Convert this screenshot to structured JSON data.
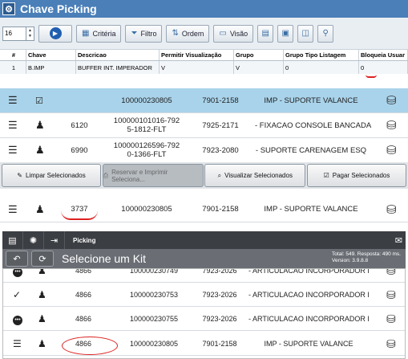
{
  "window": {
    "title": "Chave Picking"
  },
  "toolbar": {
    "spin_value": "16",
    "criteria_label": "Critéria",
    "filter_label": "Filtro",
    "order_label": "Ordem",
    "view_label": "Visão"
  },
  "grid": {
    "headers": [
      "#",
      "Chave",
      "Descricao",
      "Permitir Visualização",
      "Grupo",
      "Grupo Tipo Listagem",
      "Bloqueia Usuar"
    ],
    "row": [
      "1",
      "B.IMP",
      "BUFFER INT. IMPERADOR",
      "V",
      "V",
      "0",
      "0"
    ]
  },
  "list_top": [
    {
      "code": "",
      "order": "100000230805",
      "ref": "7901-2158",
      "desc": "IMP - SUPORTE VALANCE"
    },
    {
      "code": "6120",
      "order_line1": "100000101016-792",
      "order_line2": "5-1812-FLT",
      "ref": "7925-2171",
      "desc": "- FIXACAO CONSOLE BANCADA"
    },
    {
      "code": "6990",
      "order_line1": "100000126596-792",
      "order_line2": "0-1366-FLT",
      "ref": "7923-2080",
      "desc": "- SUPORTE CARENAGEM ESQ"
    }
  ],
  "actions": {
    "clear": "Limpar Selecionados",
    "reserve_print": "Reservar e Imprimir Selecionа...",
    "view_selected": "Visualizar Selecionados",
    "pay_selected": "Pagar Selecionados"
  },
  "single_row": {
    "code": "3737",
    "order": "100000230805",
    "ref": "7901-2158",
    "desc": "IMP - SUPORTE VALANCE"
  },
  "mobile": {
    "top_title": "Picking",
    "sub_title": "Selecione um Kit",
    "stats_line1": "Total: 549. Resposta: 490 ms.",
    "stats_line2": "Version: 3.9.8.8"
  },
  "list_bottom": [
    {
      "code": "4866",
      "order": "100000230749",
      "ref": "7923-2026",
      "desc": "- ARTICULACAO INCORPORADOR I"
    },
    {
      "code": "4866",
      "order": "100000230753",
      "ref": "7923-2026",
      "desc": "- ARTICULACAO INCORPORADOR I"
    },
    {
      "code": "4866",
      "order": "100000230755",
      "ref": "7923-2026",
      "desc": "- ARTICULACAO INCORPORADOR I"
    },
    {
      "code": "4866",
      "order": "100000230805",
      "ref": "7901-2158",
      "desc": "IMP - SUPORTE VALANCE"
    }
  ],
  "colors": {
    "title_bar": "#4a7fb8",
    "selected_row": "#a9d3ea",
    "annotation": "#dd2222",
    "dark_bar": "#3b3e43"
  }
}
